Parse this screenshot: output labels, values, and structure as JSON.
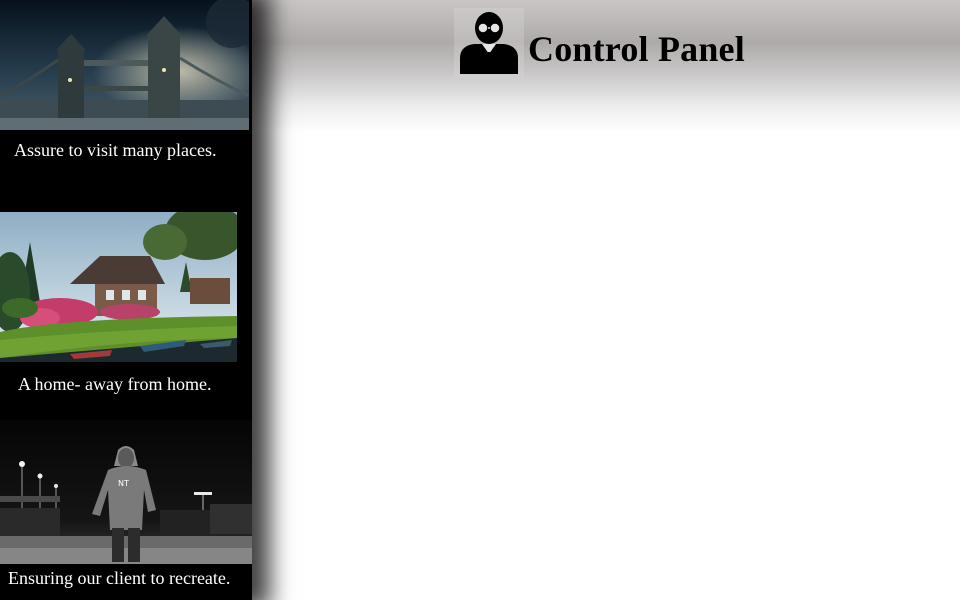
{
  "header": {
    "title": "Control Panel",
    "logo_icon": "businessman-glasses-icon",
    "gradient_colors": [
      "#c9c6c5",
      "#aeaaaa",
      "#ffffff"
    ]
  },
  "sidebar": {
    "background": "#000000",
    "cards": [
      {
        "image": "tower-bridge-night-photo",
        "caption": "Assure to visit many places."
      },
      {
        "image": "country-house-garden-photo",
        "caption": "A home- away from home."
      },
      {
        "image": "hooded-man-night-street-photo",
        "caption": "Ensuring our client to recreate."
      }
    ]
  }
}
